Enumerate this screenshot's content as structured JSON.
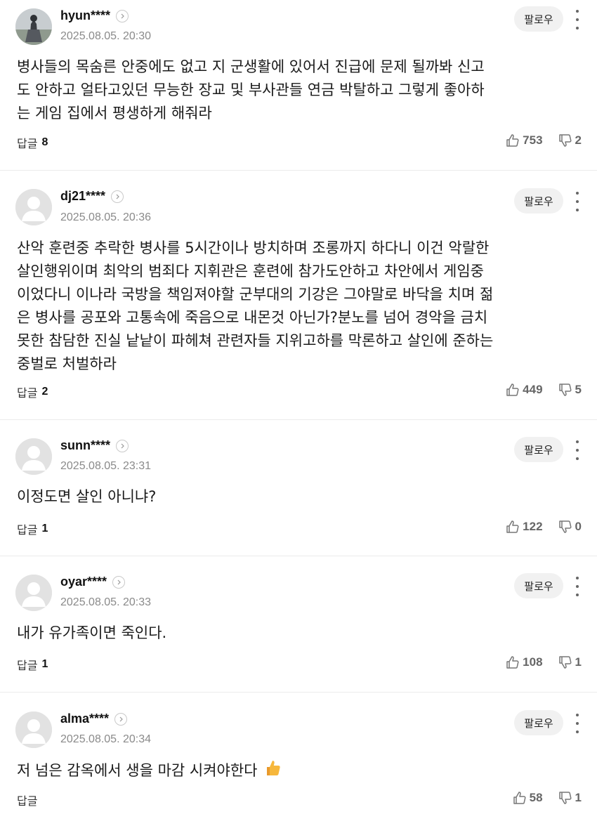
{
  "comments": [
    {
      "username": "hyun****",
      "date": "2025.08.05. 20:30",
      "text": "병사들의 목숨른 안중에도 없고 지 군생활에 있어서 진급에 문제 될까봐 신고\n도 안하고 얼타고있던 무능한 장교 및 부사관들 연금 박탈하고 그렇게 좋아하\n는 게임 집에서 평생하게 해줘라",
      "reply_label": "답글",
      "reply_count": "8",
      "likes": "753",
      "dislikes": "2",
      "follow_label": "팔로우",
      "avatar": "photo"
    },
    {
      "username": "dj21****",
      "date": "2025.08.05. 20:36",
      "text": "산악 훈련중 추락한 병사를 5시간이나 방치하며 조롱까지 하다니 이건 악랄한\n살인행위이며 최악의 범죄다 지휘관은 훈련에 참가도안하고 차안에서 게임중\n이었다니 이나라 국방을 책임져야할 군부대의 기강은 그야말로 바닥을 치며 젊\n은 병사를 공포와 고통속에 죽음으로 내몬것 아닌가?분노를 넘어 경악을 금치\n못한 참담한 진실 낱낱이 파헤쳐 관련자들 지위고하를 막론하고 살인에 준하는\n중벌로 처벌하라",
      "reply_label": "답글",
      "reply_count": "2",
      "likes": "449",
      "dislikes": "5",
      "follow_label": "팔로우",
      "avatar": "default"
    },
    {
      "username": "sunn****",
      "date": "2025.08.05. 23:31",
      "text": "이정도면 살인 아니냐?",
      "reply_label": "답글",
      "reply_count": "1",
      "likes": "122",
      "dislikes": "0",
      "follow_label": "팔로우",
      "avatar": "default"
    },
    {
      "username": "oyar****",
      "date": "2025.08.05. 20:33",
      "text": "내가 유가족이면 죽인다.",
      "reply_label": "답글",
      "reply_count": "1",
      "likes": "108",
      "dislikes": "1",
      "follow_label": "팔로우",
      "avatar": "default"
    },
    {
      "username": "alma****",
      "date": "2025.08.05. 20:34",
      "text": "저 넘은 감옥에서 생을 마감 시켜야한다",
      "emoji": "thumbs-up-emoji",
      "reply_label": "답글",
      "reply_count": "",
      "likes": "58",
      "dislikes": "1",
      "follow_label": "팔로우",
      "avatar": "default"
    }
  ]
}
